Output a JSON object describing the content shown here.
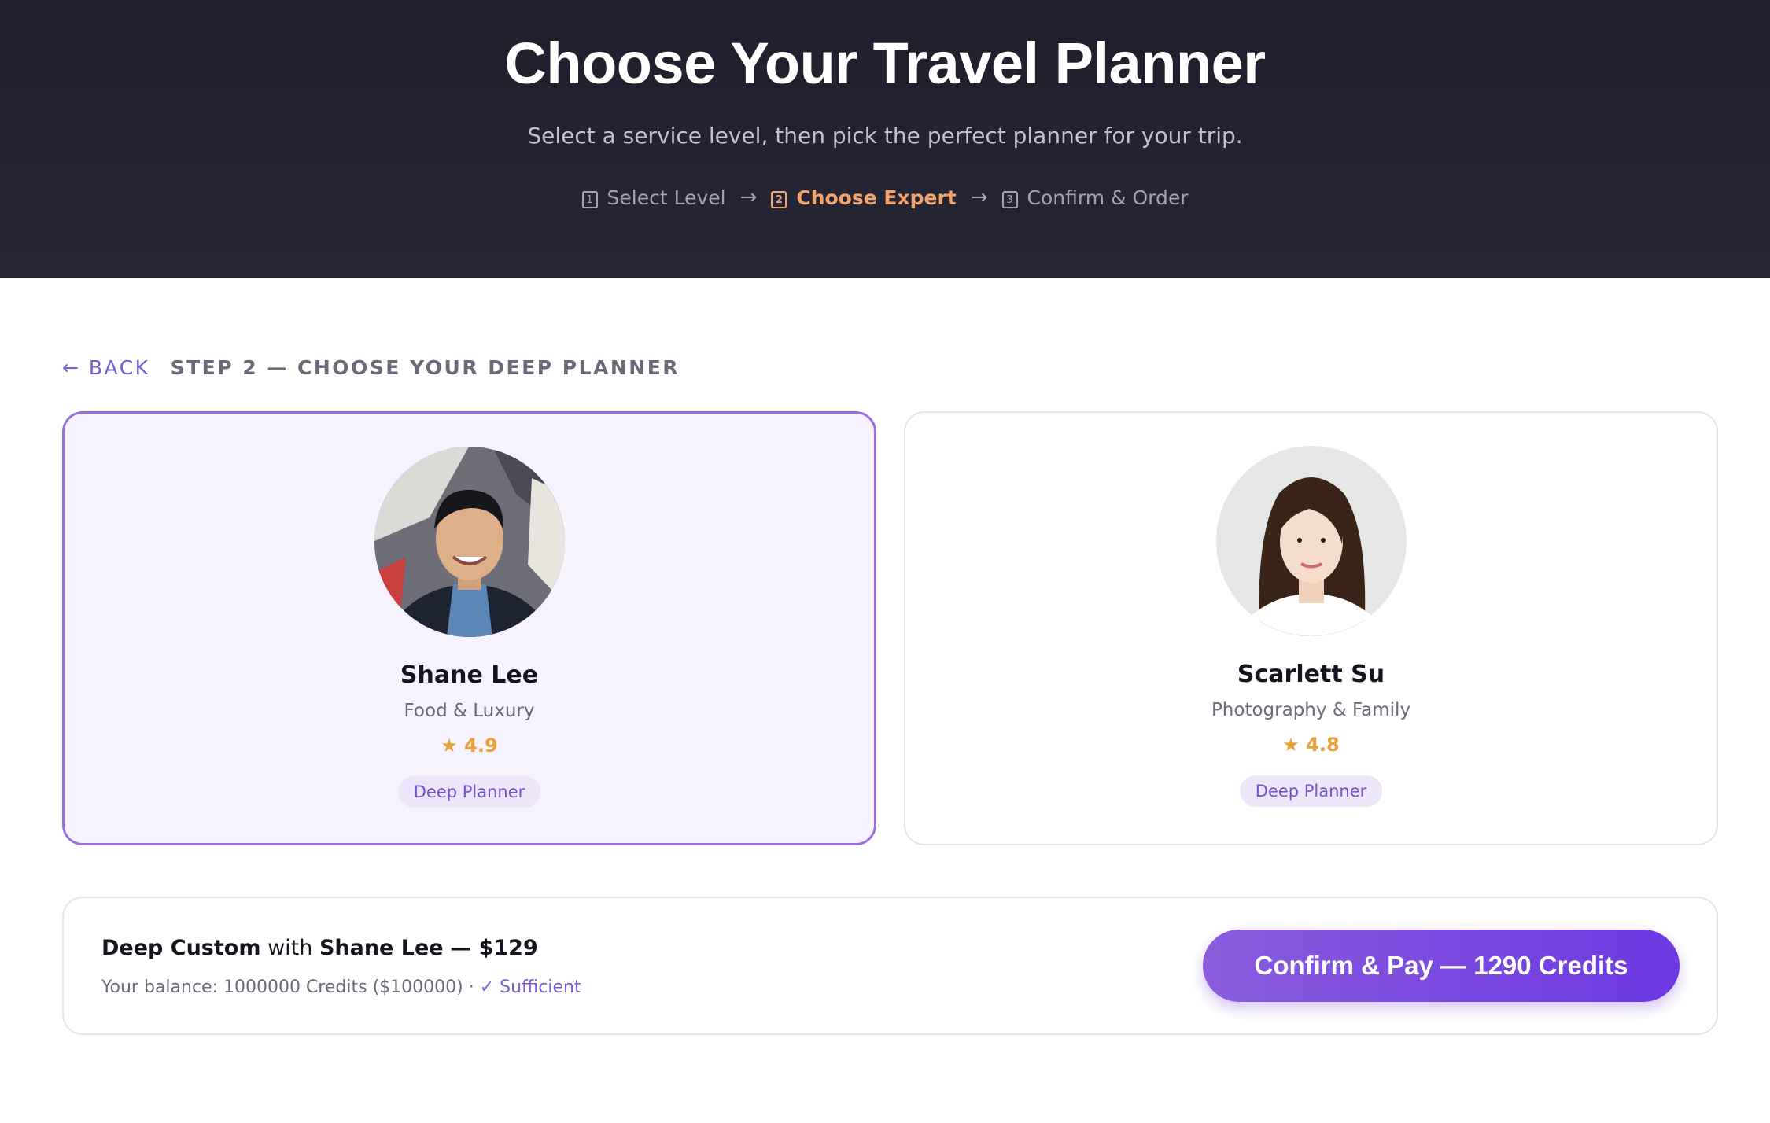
{
  "header": {
    "title": "Choose Your Travel Planner",
    "subtitle": "Select a service level, then pick the perfect planner for your trip.",
    "steps": [
      {
        "number": "1",
        "label": "Select Level",
        "active": false
      },
      {
        "number": "2",
        "label": "Choose Expert",
        "active": true
      },
      {
        "number": "3",
        "label": "Confirm & Order",
        "active": false
      }
    ],
    "arrow": "→"
  },
  "nav": {
    "back_label": "← BACK",
    "step_heading": "STEP 2 — CHOOSE YOUR DEEP PLANNER"
  },
  "planners": [
    {
      "name": "Shane Lee",
      "specialty": "Food & Luxury",
      "rating": "★ 4.9",
      "badge": "Deep Planner",
      "selected": true
    },
    {
      "name": "Scarlett Su",
      "specialty": "Photography & Family",
      "rating": "★ 4.8",
      "badge": "Deep Planner",
      "selected": false
    }
  ],
  "summary": {
    "service": "Deep Custom",
    "with_word": "with",
    "planner": "Shane Lee",
    "price": "— $129",
    "balance": "Your balance: 1000000 Credits ($100000) ·",
    "status": "✓ Sufficient",
    "button_label": "Confirm & Pay — 1290 Credits"
  },
  "colors": {
    "header_bg": "#1e1e2c",
    "accent": "#7a5bd6",
    "active_step": "#f2a46c",
    "rating": "#e8a23a",
    "selected_card_bg": "#f7f3fe"
  }
}
